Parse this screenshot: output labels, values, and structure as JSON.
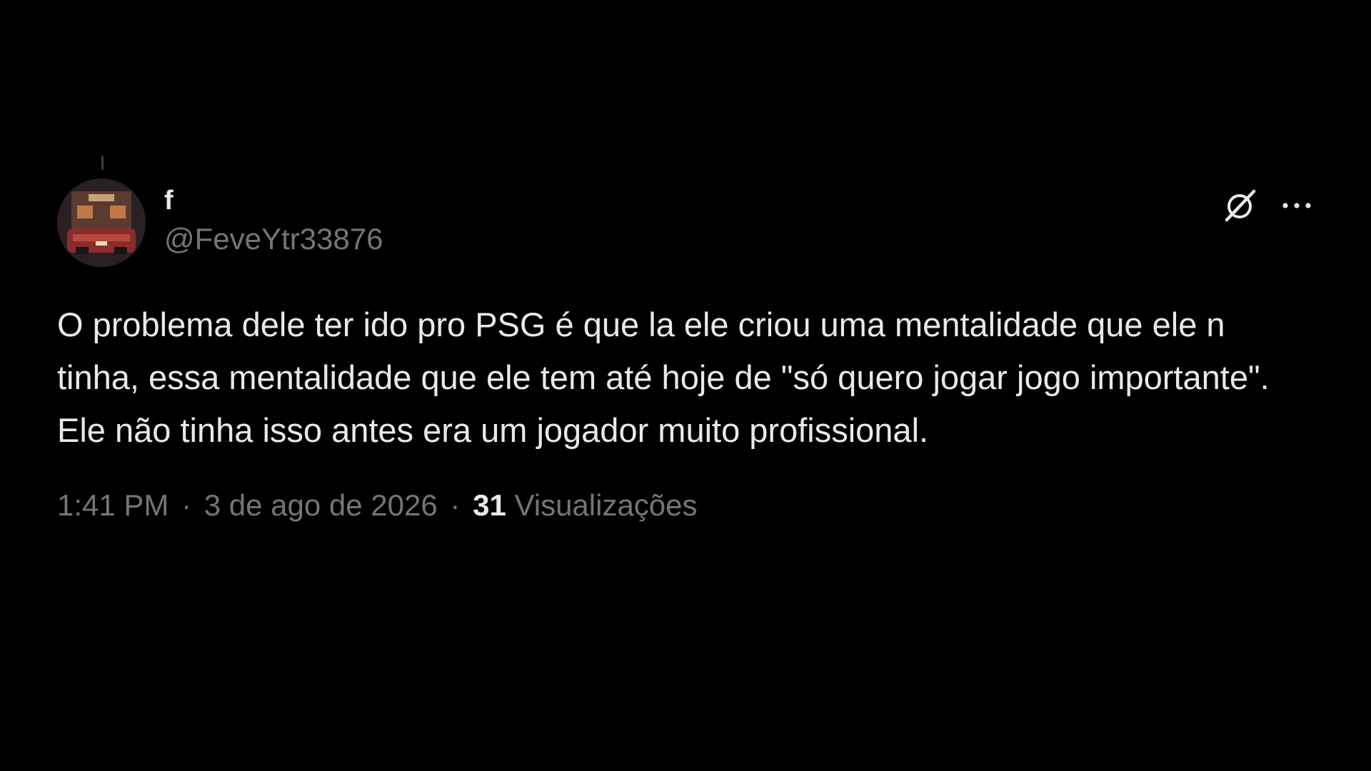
{
  "tweet": {
    "author": {
      "display_name": "f",
      "handle": "@FeveYtr33876",
      "avatar": "avatar-image"
    },
    "text": "O problema dele ter ido pro PSG é que la ele criou uma mentalidade que ele n tinha, essa mentalidade que ele tem até hoje de \"só quero jogar jogo importante\". Ele não tinha isso antes era um jogador muito profissional.",
    "time": "1:41 PM",
    "separator": "·",
    "date": "3 de ago de 2026",
    "views_count": "31",
    "views_label": "Visualizações"
  },
  "icons": {
    "grok": "grok-icon",
    "more": "more-icon"
  },
  "colors": {
    "background": "#000000",
    "primary_text": "#e7e9ea",
    "secondary_text": "#71767b"
  }
}
